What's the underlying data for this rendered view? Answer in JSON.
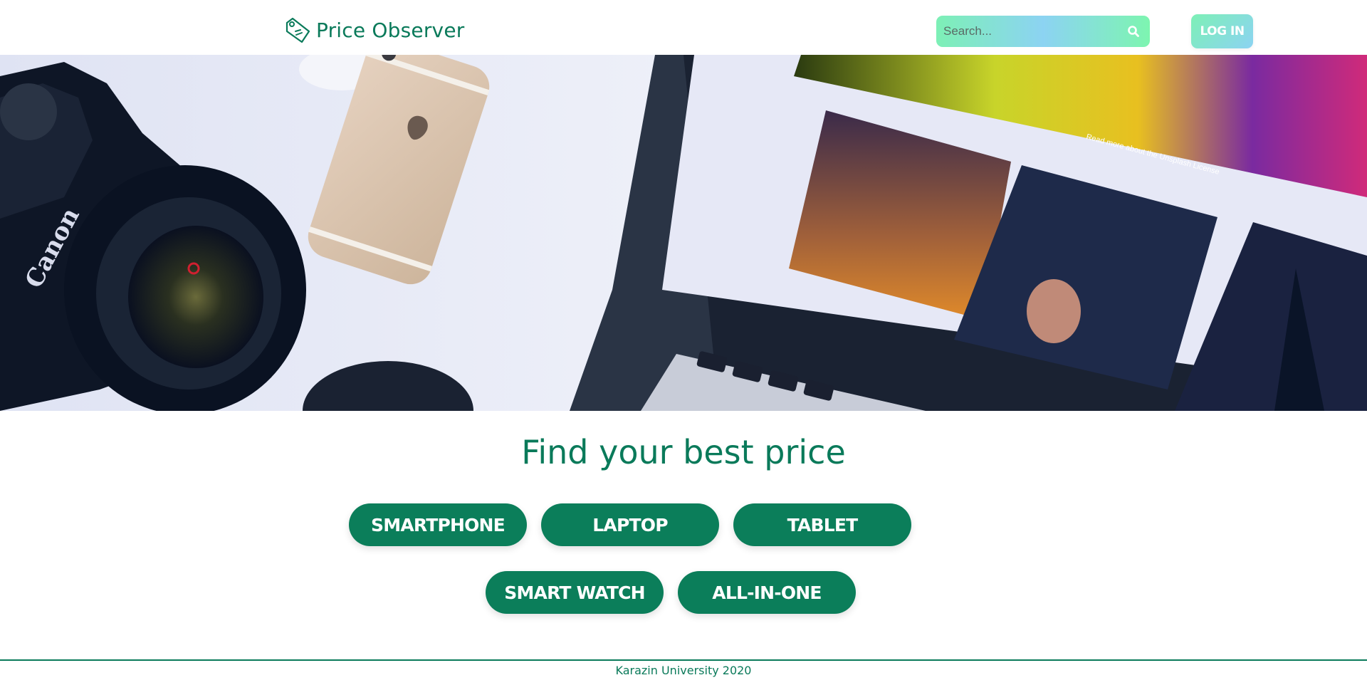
{
  "brand": {
    "name": "Price Observer",
    "color": "#0a7a5a",
    "icon": "price-tag-icon"
  },
  "search": {
    "placeholder": "Search...",
    "value": "",
    "icon": "search-icon"
  },
  "header": {
    "login_label": "LOG IN"
  },
  "hero": {
    "image": "hero-photo-camera-phone-laptop",
    "camera_brand_text": "Canon",
    "laptop_screen_caption": "Read more about the Unsplash License"
  },
  "main": {
    "headline": "Find your best price",
    "categories": [
      {
        "label": "SMARTPHONE"
      },
      {
        "label": "LAPTOP"
      },
      {
        "label": "TABLET"
      },
      {
        "label": "SMART WATCH"
      },
      {
        "label": "ALL-IN-ONE"
      }
    ]
  },
  "footer": {
    "text": "Karazin University 2020"
  },
  "colors": {
    "accent": "#0b7e5a",
    "gradient_start": "#7df0b6",
    "gradient_mid": "#8cd3f2"
  }
}
